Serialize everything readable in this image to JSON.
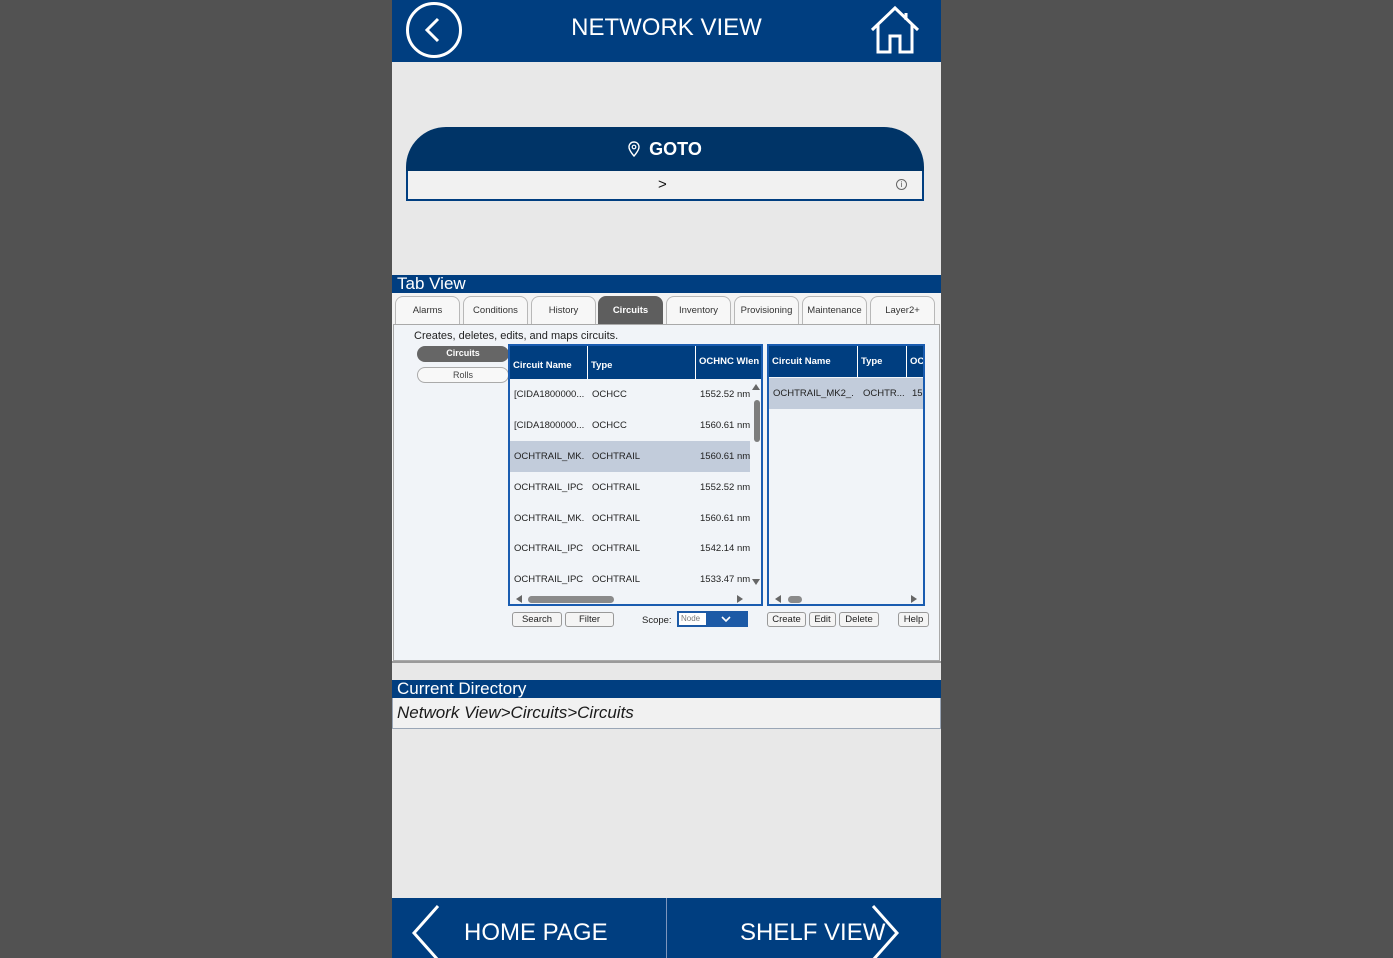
{
  "header": {
    "title": "NETWORK VIEW",
    "back_icon": "chevron-left-circle-icon",
    "home_icon": "home-icon"
  },
  "goto": {
    "title": "GOTO",
    "icon": "map-pin-icon",
    "field_arrow": ">",
    "info_icon": "ⓘ"
  },
  "tab_view": {
    "title": "Tab View",
    "tabs": [
      {
        "label": "Alarms"
      },
      {
        "label": "Conditions"
      },
      {
        "label": "History"
      },
      {
        "label": "Circuits",
        "active": true
      },
      {
        "label": "Inventory"
      },
      {
        "label": "Provisioning"
      },
      {
        "label": "Maintenance"
      },
      {
        "label": "Layer2+"
      }
    ],
    "description": "Creates, deletes, edits, and maps circuits.",
    "subtabs": [
      {
        "label": "Circuits",
        "active": true
      },
      {
        "label": "Rolls"
      }
    ],
    "left_table": {
      "headers": [
        "Circuit Name",
        "Type",
        "OCHNC Wlen"
      ],
      "rows": [
        [
          "[CIDA1800000...",
          "OCHCC",
          "1552.52 nm"
        ],
        [
          "[CIDA1800000...",
          "OCHCC",
          "1560.61 nm"
        ],
        [
          "OCHTRAIL_MK...",
          "OCHTRAIL",
          "1560.61 nm"
        ],
        [
          "OCHTRAIL_IPC...",
          "OCHTRAIL",
          "1552.52 nm"
        ],
        [
          "OCHTRAIL_MK...",
          "OCHTRAIL",
          "1560.61 nm"
        ],
        [
          "OCHTRAIL_IPC...",
          "OCHTRAIL",
          "1542.14 nm"
        ],
        [
          "OCHTRAIL_IPC...",
          "OCHTRAIL",
          "1533.47 nm"
        ]
      ],
      "selected_row": 2
    },
    "right_table": {
      "headers": [
        "Circuit Name",
        "Type",
        "OC"
      ],
      "rows": [
        [
          "OCHTRAIL_MK2_...",
          "OCHTR...",
          "15("
        ]
      ]
    },
    "buttons": {
      "search": "Search",
      "filter": "Filter",
      "scope_label": "Scope:",
      "scope_value": "Node",
      "create": "Create",
      "edit": "Edit",
      "delete": "Delete",
      "help": "Help"
    }
  },
  "current_directory": {
    "title": "Current Directory",
    "path": "Network View>Circuits>Circuits"
  },
  "bottom_nav": {
    "home_page": "HOME PAGE",
    "shelf_view": "SHELF VIEW"
  },
  "colors": {
    "primary": "#003e80",
    "goto_header": "#003467",
    "background": "#e8e8e8",
    "outer": "#525252",
    "selected_row": "#c2ccdb"
  }
}
